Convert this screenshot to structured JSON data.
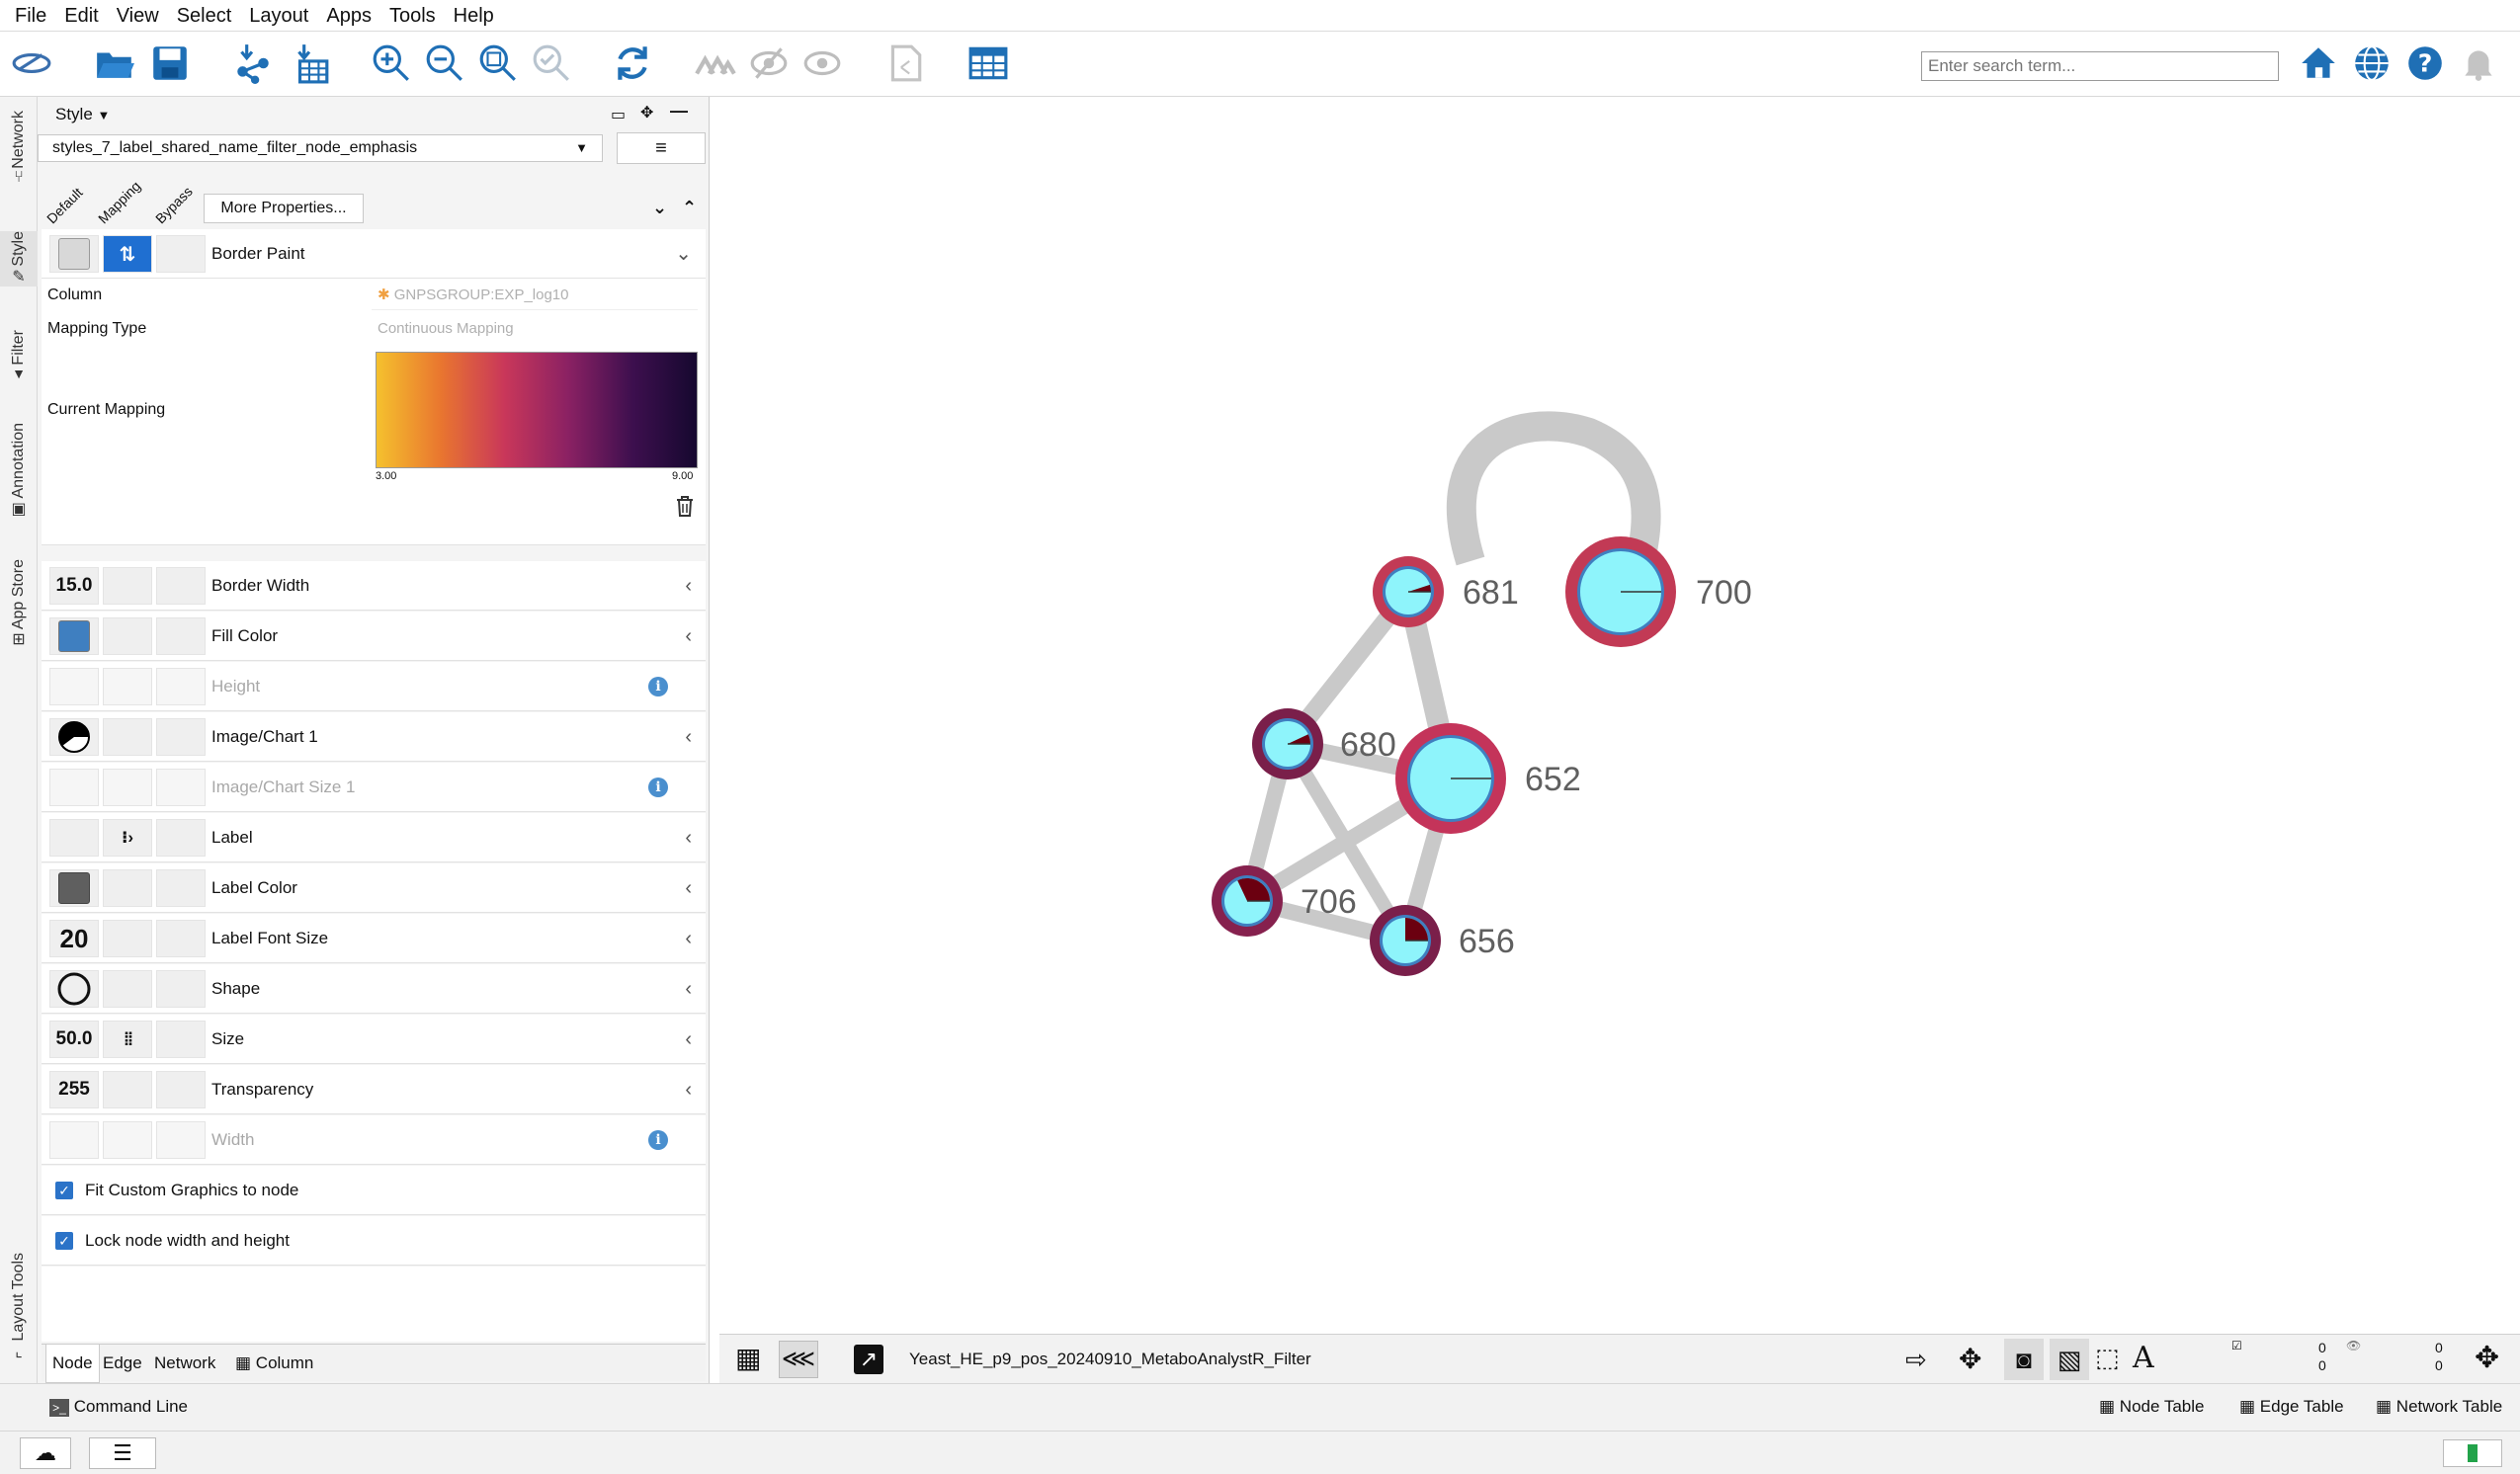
{
  "menu": [
    "File",
    "Edit",
    "View",
    "Select",
    "Layout",
    "Apps",
    "Tools",
    "Help"
  ],
  "search": {
    "placeholder": "Enter search term..."
  },
  "side_tabs": [
    "Network",
    "Style",
    "Filter",
    "Annotation",
    "App Store",
    "Layout Tools"
  ],
  "style_panel": {
    "header": "Style",
    "style_name": "styles_7_label_shared_name_filter_node_emphasis",
    "col_headers": [
      "Default",
      "Mapping",
      "Bypass"
    ],
    "more_properties": "More Properties...",
    "border_paint": {
      "label": "Border Paint",
      "column_label": "Column",
      "column_value": "GNPSGROUP:EXP_log10",
      "mapping_type_label": "Mapping Type",
      "mapping_type_value": "Continuous Mapping",
      "current_mapping_label": "Current Mapping",
      "range_min": "3.00",
      "range_max": "9.00",
      "gradient_colors": [
        "#f5c12e",
        "#e9762f",
        "#c9375a",
        "#8a2163",
        "#3d0f4e",
        "#16082f"
      ]
    },
    "properties": [
      {
        "label": "Border Width",
        "default": "15.0"
      },
      {
        "label": "Fill Color",
        "default_color": "#3f7fc0"
      },
      {
        "label": "Height"
      },
      {
        "label": "Image/Chart 1"
      },
      {
        "label": "Image/Chart Size 1"
      },
      {
        "label": "Label"
      },
      {
        "label": "Label Color",
        "default_color": "#5f5f5f"
      },
      {
        "label": "Label Font Size",
        "default": "20"
      },
      {
        "label": "Shape"
      },
      {
        "label": "Size",
        "default": "50.0"
      },
      {
        "label": "Transparency",
        "default": "255"
      },
      {
        "label": "Width"
      }
    ],
    "checkboxes": [
      "Fit Custom Graphics to node",
      "Lock node width and height"
    ],
    "bottom_tabs": [
      "Node",
      "Edge",
      "Network",
      "Column"
    ]
  },
  "network": {
    "title": "Yeast_HE_p9_pos_20240910_MetaboAnalystR_Filter",
    "node_fill": "#8ef4fb",
    "edge_color": "#c9c9c9",
    "nodes": [
      {
        "id": "681",
        "border": "#c23a55",
        "pie": 0.05
      },
      {
        "id": "700",
        "border": "#c23a55",
        "pie": 0.0
      },
      {
        "id": "680",
        "border": "#7a1f4a",
        "pie": 0.07
      },
      {
        "id": "652",
        "border": "#c4345a",
        "pie": 0.0
      },
      {
        "id": "706",
        "border": "#86214e",
        "pie": 0.32
      },
      {
        "id": "656",
        "border": "#7a1f4a",
        "pie": 0.25
      }
    ]
  },
  "selection_counts": [
    "0",
    "0",
    "0",
    "0"
  ],
  "status": {
    "command_line": "Command Line",
    "node_table": "Node Table",
    "edge_table": "Edge Table",
    "network_table": "Network Table"
  }
}
